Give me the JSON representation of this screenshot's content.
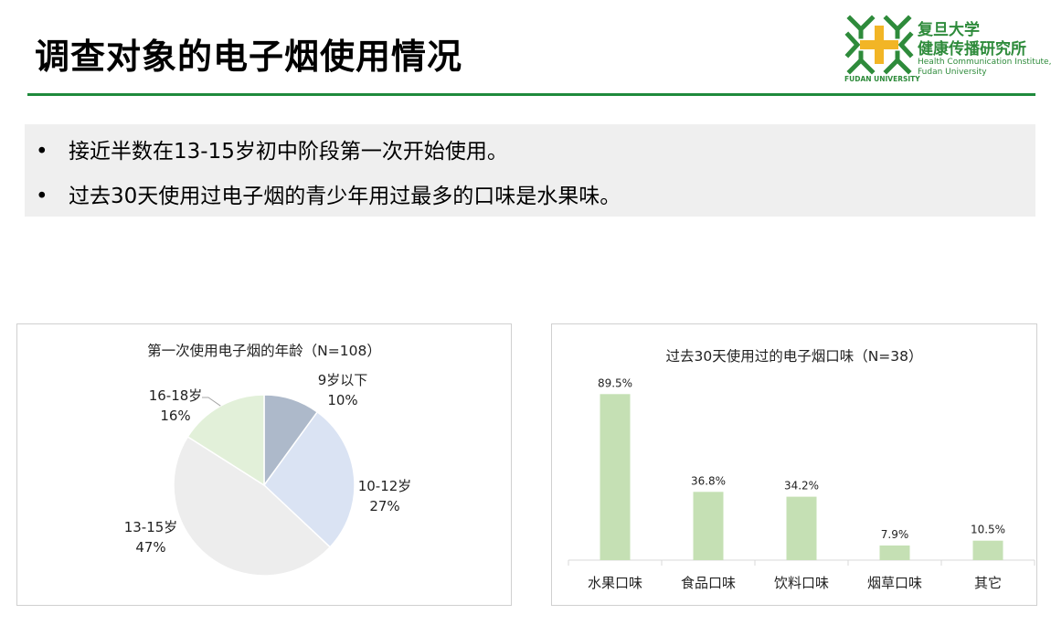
{
  "page": {
    "title": "调查对象的电子烟使用情况",
    "logo": {
      "zh_line1": "复旦大学",
      "zh_line2": "健康传播研究所",
      "en_line1": "Health Communication Institute,",
      "en_line2": "Fudan University",
      "university": "FUDAN UNIVERSITY"
    },
    "bullets": [
      "接近半数在13-15岁初中阶段第一次开始使用。",
      "过去30天使用过电子烟的青少年用过最多的口味是水果味。"
    ],
    "bullet_symbol": "•"
  },
  "colors": {
    "title_rule": "#1f8a3c",
    "logo_green": "#2e8b3b",
    "logo_yellow": "#f2b526",
    "bar": "#c5e0b4"
  },
  "chart_data": [
    {
      "type": "pie",
      "title": "第一次使用电子烟的年龄（N=108）",
      "slices": [
        {
          "label": "9岁以下",
          "value": 10,
          "value_label": "10%",
          "color": "#adb9ca"
        },
        {
          "label": "10-12岁",
          "value": 27,
          "value_label": "27%",
          "color": "#dae3f3"
        },
        {
          "label": "13-15岁",
          "value": 47,
          "value_label": "47%",
          "color": "#ededed"
        },
        {
          "label": "16-18岁",
          "value": 16,
          "value_label": "16%",
          "color": "#e2f0d9"
        }
      ]
    },
    {
      "type": "bar",
      "title": "过去30天使用过的电子烟口味（N=38）",
      "categories": [
        "水果口味",
        "食品口味",
        "饮料口味",
        "烟草口味",
        "其它"
      ],
      "values": [
        89.5,
        36.8,
        34.2,
        7.9,
        10.5
      ],
      "value_labels": [
        "89.5%",
        "36.8%",
        "34.2%",
        "7.9%",
        "10.5%"
      ],
      "ylim": [
        0,
        100
      ],
      "grid": false,
      "legend": "none"
    }
  ]
}
